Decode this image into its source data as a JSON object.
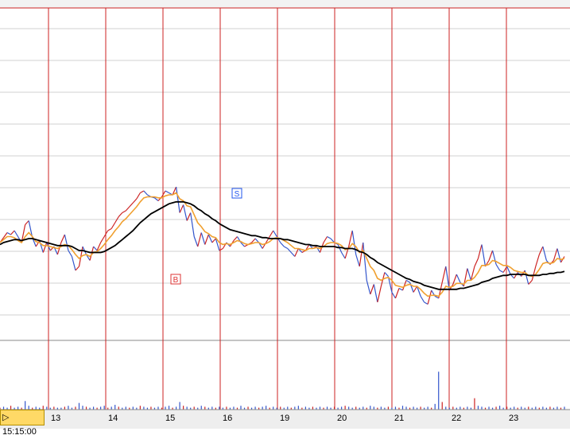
{
  "chart_data": {
    "type": "line",
    "cursor_time_label": "▷ 15:15:00",
    "x_tick_labels": [
      "13",
      "14",
      "15",
      "16",
      "19",
      "20",
      "21",
      "22",
      "23"
    ],
    "grid": true,
    "colors": {
      "price": "#3355cc",
      "price_alt": "#cc2222",
      "ma_short": "#f0a030",
      "ma_long": "#000000",
      "day_separator": "#cc2222",
      "volume": "#3355cc"
    },
    "markers": [
      {
        "label": "S",
        "color": "#2255ee",
        "day": "16"
      },
      {
        "label": "B",
        "color": "#dd3333",
        "day": "15"
      }
    ],
    "series": [
      {
        "values": [
          300,
          305,
          310,
          308,
          312,
          306,
          300,
          318,
          322,
          305,
          296,
          302,
          290,
          300,
          292,
          296,
          288,
          300,
          308,
          292,
          286,
          272,
          276,
          296,
          288,
          282,
          296,
          292,
          300,
          306,
          312,
          314,
          320,
          326,
          330,
          332,
          336,
          340,
          344,
          350,
          352,
          348,
          346,
          345,
          342,
          346,
          352,
          350,
          348,
          356,
          330,
          338,
          322,
          330,
          306,
          296,
          310,
          298,
          308,
          300,
          304,
          292,
          294,
          300,
          296,
          302,
          306,
          300,
          296,
          298,
          300,
          304,
          300,
          294,
          300,
          306,
          312,
          306,
          300,
          296,
          294,
          290,
          286,
          294,
          290,
          292,
          298,
          294,
          296,
          290,
          300,
          306,
          304,
          300,
          298,
          290,
          284,
          296,
          312,
          288,
          276,
          300,
          262,
          248,
          258,
          240,
          256,
          270,
          266,
          250,
          244,
          254,
          252,
          262,
          260,
          250,
          256,
          246,
          240,
          238,
          252,
          246,
          244,
          260,
          276,
          252,
          258,
          268,
          260,
          256,
          274,
          262,
          276,
          284,
          298,
          276,
          282,
          292,
          278,
          272,
          270,
          276,
          268,
          264,
          270,
          266,
          272,
          258,
          262,
          276,
          288,
          296,
          282,
          278,
          282,
          294,
          280,
          286
        ]
      },
      {
        "values": [
          300,
          303,
          306,
          306,
          305,
          302,
          300,
          306,
          310,
          306,
          301,
          300,
          297,
          297,
          296,
          295,
          294,
          296,
          298,
          297,
          293,
          288,
          284,
          287,
          288,
          286,
          290,
          291,
          294,
          298,
          303,
          307,
          312,
          316,
          321,
          324,
          328,
          332,
          336,
          341,
          345,
          346,
          346,
          346,
          345,
          345,
          347,
          348,
          348,
          350,
          344,
          342,
          337,
          336,
          328,
          320,
          316,
          311,
          309,
          306,
          305,
          300,
          298,
          299,
          298,
          300,
          302,
          301,
          299,
          298,
          299,
          300,
          300,
          298,
          299,
          301,
          304,
          305,
          304,
          302,
          300,
          297,
          294,
          294,
          293,
          292,
          294,
          294,
          295,
          294,
          296,
          299,
          300,
          300,
          299,
          297,
          293,
          294,
          299,
          296,
          290,
          292,
          284,
          276,
          272,
          264,
          262,
          264,
          265,
          262,
          257,
          256,
          255,
          257,
          258,
          256,
          256,
          253,
          249,
          246,
          247,
          247,
          246,
          250,
          256,
          255,
          256,
          259,
          259,
          258,
          262,
          262,
          265,
          270,
          277,
          277,
          278,
          282,
          281,
          279,
          277,
          277,
          275,
          272,
          271,
          270,
          270,
          267,
          266,
          268,
          273,
          279,
          280,
          279,
          280,
          284,
          283,
          284
        ]
      },
      {
        "values": [
          298,
          300,
          301,
          302,
          303,
          303,
          302,
          303,
          304,
          304,
          303,
          302,
          301,
          300,
          299,
          298,
          297,
          297,
          297,
          297,
          296,
          294,
          292,
          292,
          291,
          290,
          290,
          290,
          290,
          291,
          293,
          295,
          297,
          300,
          303,
          306,
          309,
          312,
          316,
          320,
          323,
          326,
          329,
          331,
          333,
          335,
          337,
          339,
          340,
          341,
          341,
          341,
          340,
          339,
          337,
          334,
          332,
          329,
          327,
          324,
          322,
          319,
          317,
          315,
          313,
          312,
          311,
          310,
          309,
          308,
          307,
          307,
          306,
          305,
          305,
          304,
          304,
          304,
          304,
          303,
          303,
          302,
          301,
          300,
          299,
          298,
          298,
          297,
          297,
          296,
          296,
          296,
          296,
          296,
          295,
          295,
          294,
          294,
          294,
          293,
          291,
          290,
          288,
          285,
          283,
          280,
          278,
          276,
          274,
          272,
          270,
          268,
          266,
          264,
          263,
          261,
          260,
          259,
          257,
          256,
          255,
          254,
          253,
          253,
          253,
          253,
          253,
          253,
          254,
          254,
          255,
          256,
          257,
          258,
          260,
          261,
          262,
          264,
          265,
          266,
          267,
          267,
          268,
          268,
          268,
          268,
          268,
          267,
          267,
          267,
          267,
          268,
          268,
          269,
          269,
          270,
          270,
          271
        ]
      }
    ],
    "volume": [
      2,
      3,
      2,
      4,
      2,
      3,
      2,
      9,
      4,
      2,
      3,
      2,
      4,
      3,
      2,
      3,
      2,
      2,
      3,
      4,
      2,
      3,
      7,
      4,
      3,
      2,
      3,
      2,
      3,
      4,
      2,
      3,
      5,
      3,
      2,
      3,
      2,
      3,
      2,
      4,
      3,
      2,
      3,
      2,
      3,
      2,
      3,
      4,
      2,
      3,
      8,
      4,
      3,
      2,
      3,
      2,
      4,
      3,
      2,
      3,
      2,
      3,
      2,
      3,
      2,
      3,
      2,
      4,
      2,
      3,
      2,
      3,
      2,
      3,
      4,
      2,
      3,
      2,
      3,
      2,
      3,
      2,
      3,
      4,
      2,
      3,
      2,
      3,
      2,
      3,
      2,
      3,
      2,
      3,
      2,
      3,
      4,
      3,
      2,
      3,
      2,
      3,
      2,
      4,
      3,
      2,
      3,
      2,
      3,
      2,
      3,
      2,
      4,
      3,
      2,
      3,
      2,
      3,
      2,
      3,
      2,
      6,
      40,
      8,
      3,
      2,
      3,
      2,
      3,
      2,
      3,
      2,
      12,
      4,
      3,
      2,
      3,
      2,
      3,
      4,
      2,
      3,
      2,
      3,
      2,
      3,
      2,
      3,
      2,
      3,
      2,
      3,
      2,
      3,
      2,
      3,
      2,
      3
    ]
  }
}
